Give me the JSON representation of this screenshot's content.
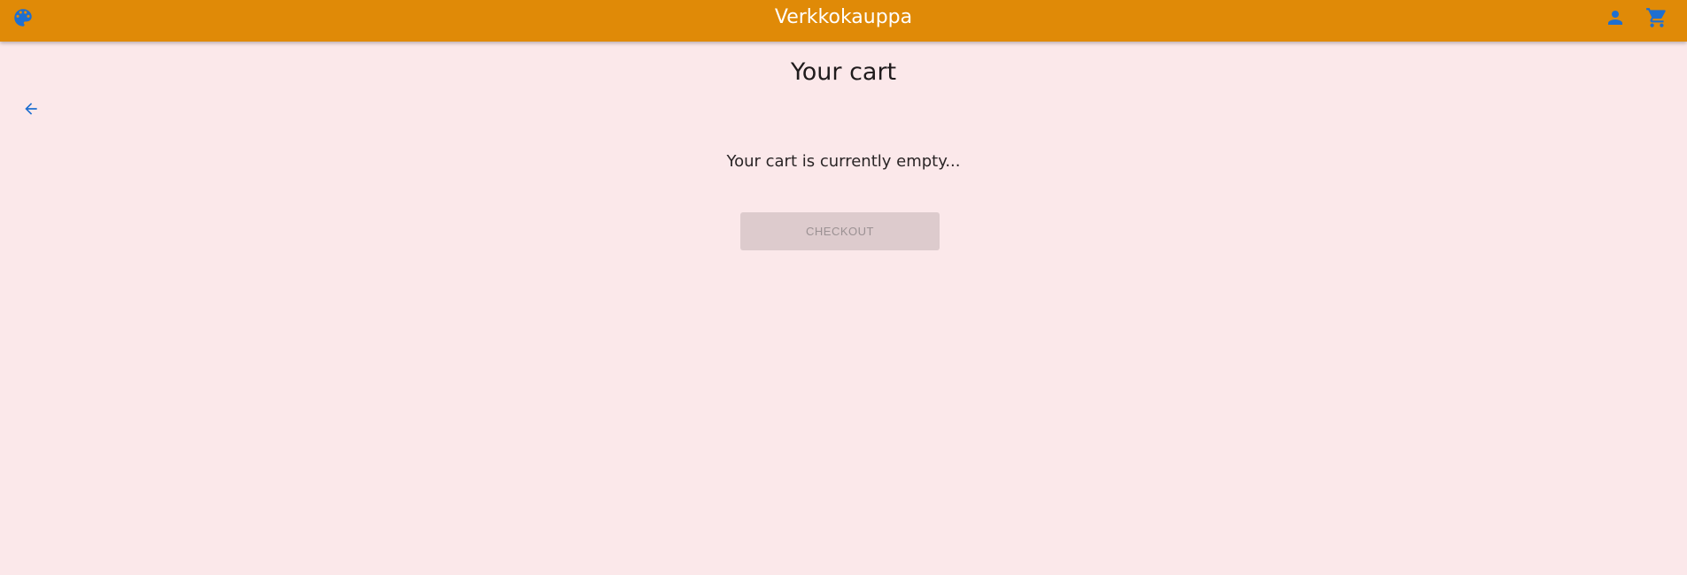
{
  "header": {
    "title": "Verkkokauppa",
    "icons": {
      "left": "palette-icon",
      "account": "account-icon",
      "cart": "shopping-cart-icon"
    },
    "background_color": "#e08a07",
    "icon_color": "#1e6fd0"
  },
  "main": {
    "title": "Your cart",
    "back_icon": "arrow-back-icon",
    "empty_message": "Your cart is currently empty...",
    "checkout_label": "CHECKOUT",
    "checkout_enabled": false,
    "background_color": "#fbe8ea"
  }
}
